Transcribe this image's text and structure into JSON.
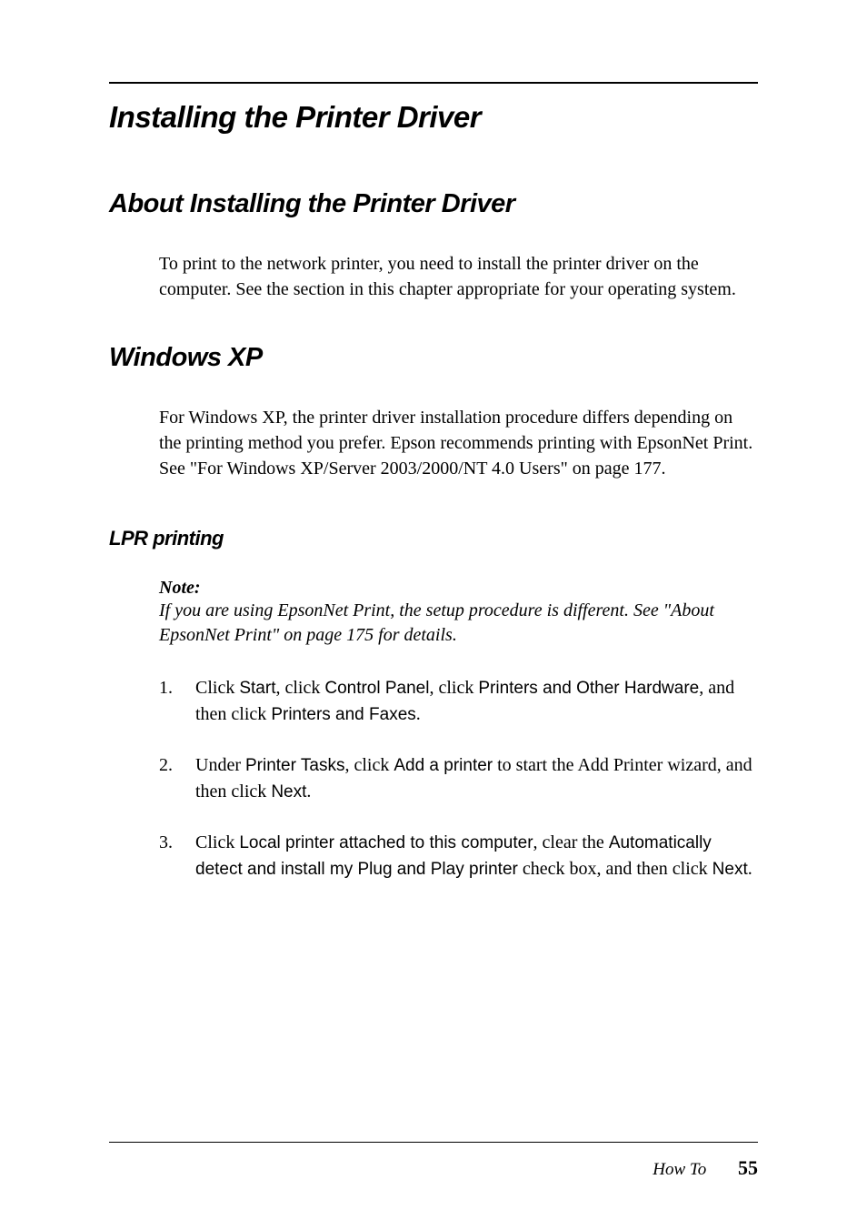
{
  "h1": "Installing the Printer Driver",
  "section1": {
    "heading": "About Installing the Printer Driver",
    "body": "To print to the network printer, you need to install the printer driver on the computer. See the section in this chapter appropriate for your operating system."
  },
  "section2": {
    "heading": "Windows XP",
    "body": "For Windows XP, the printer driver installation procedure differs depending on the printing method you prefer. Epson recommends printing with EpsonNet Print. See  \"For Windows XP/Server 2003/2000/NT 4.0 Users\" on page 177."
  },
  "lpr": {
    "heading": "LPR printing",
    "note_label": "Note:",
    "note_text": "If you are using EpsonNet Print, the setup procedure is different. See \"About EpsonNet Print\" on page 175 for details.",
    "items": [
      {
        "num": "1.",
        "parts": [
          {
            "t": "plain",
            "v": "Click "
          },
          {
            "t": "ui",
            "v": "Start"
          },
          {
            "t": "plain",
            "v": ", click "
          },
          {
            "t": "ui",
            "v": "Control Panel"
          },
          {
            "t": "plain",
            "v": ", click "
          },
          {
            "t": "ui",
            "v": "Printers and Other Hardware"
          },
          {
            "t": "plain",
            "v": ", and then click "
          },
          {
            "t": "ui",
            "v": "Printers and Faxes"
          },
          {
            "t": "plain",
            "v": "."
          }
        ]
      },
      {
        "num": "2.",
        "parts": [
          {
            "t": "plain",
            "v": "Under "
          },
          {
            "t": "ui",
            "v": "Printer Tasks"
          },
          {
            "t": "plain",
            "v": ", click "
          },
          {
            "t": "ui",
            "v": "Add a printer"
          },
          {
            "t": "plain",
            "v": " to start the Add Printer wizard, and then click "
          },
          {
            "t": "ui",
            "v": "Next"
          },
          {
            "t": "plain",
            "v": "."
          }
        ]
      },
      {
        "num": "3.",
        "parts": [
          {
            "t": "plain",
            "v": "Click "
          },
          {
            "t": "ui",
            "v": "Local printer attached to this computer"
          },
          {
            "t": "plain",
            "v": ", clear the "
          },
          {
            "t": "ui",
            "v": "Automatically detect and install my Plug and Play printer"
          },
          {
            "t": "plain",
            "v": " check box, and then click "
          },
          {
            "t": "ui",
            "v": "Next"
          },
          {
            "t": "plain",
            "v": "."
          }
        ]
      }
    ]
  },
  "footer": {
    "label": "How To",
    "page": "55"
  }
}
